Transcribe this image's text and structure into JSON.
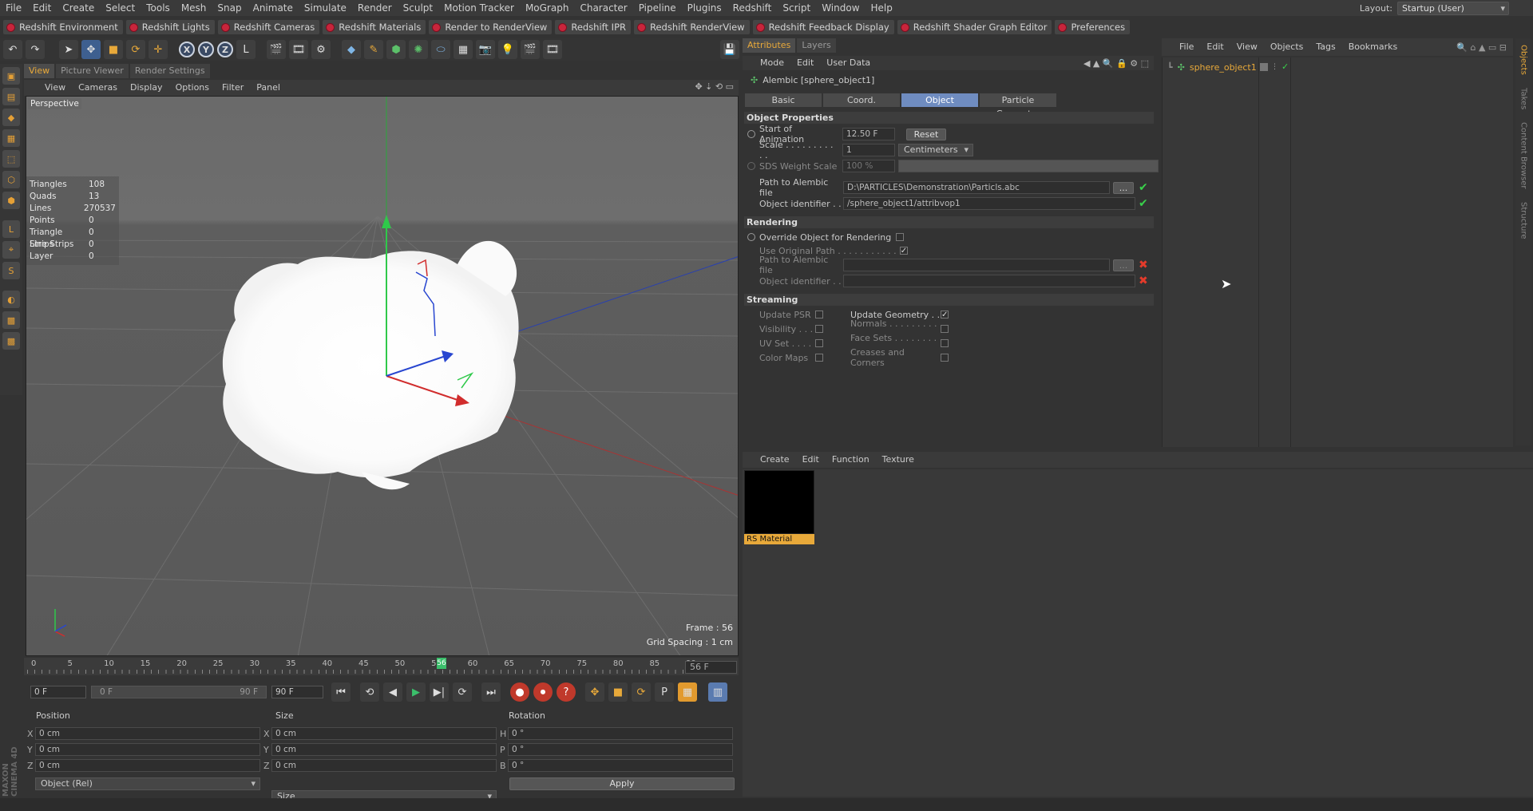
{
  "menubar": {
    "items": [
      "File",
      "Edit",
      "Create",
      "Select",
      "Tools",
      "Mesh",
      "Snap",
      "Animate",
      "Simulate",
      "Render",
      "Sculpt",
      "Motion Tracker",
      "MoGraph",
      "Character",
      "Pipeline",
      "Plugins",
      "Redshift",
      "Script",
      "Window",
      "Help"
    ],
    "layout_label": "Layout:",
    "layout_value": "Startup (User)"
  },
  "pluginbar": {
    "items": [
      "Redshift Environment",
      "Redshift Lights",
      "Redshift Cameras",
      "Redshift Materials",
      "Render to RenderView",
      "Redshift IPR",
      "Redshift RenderView",
      "Redshift Feedback Display",
      "Redshift Shader Graph Editor",
      "Preferences"
    ]
  },
  "toolbar": {
    "axis_x": "X",
    "axis_y": "Y",
    "axis_z": "Z"
  },
  "viewport": {
    "tabs": [
      "View",
      "Picture Viewer",
      "Render Settings"
    ],
    "menu": [
      "View",
      "Cameras",
      "Display",
      "Options",
      "Filter",
      "Panel"
    ],
    "camera_label": "Perspective",
    "stats": [
      {
        "k": "Triangles",
        "v": "108"
      },
      {
        "k": "Quads",
        "v": "13"
      },
      {
        "k": "Lines",
        "v": "270537"
      },
      {
        "k": "Points",
        "v": "0"
      },
      {
        "k": "Triangle Strips",
        "v": "0"
      },
      {
        "k": "Line Strips",
        "v": "0"
      },
      {
        "k": "Layer",
        "v": "0"
      }
    ],
    "frame_readout": "Frame : 56",
    "grid_readout": "Grid Spacing : 1 cm"
  },
  "timeline": {
    "ticks": [
      "0",
      "5",
      "10",
      "15",
      "20",
      "25",
      "30",
      "35",
      "40",
      "45",
      "50",
      "55",
      "60",
      "65",
      "70",
      "75",
      "80",
      "85",
      "90"
    ],
    "current_frame": "56",
    "end_field": "56 F",
    "start_field": "0 F",
    "range_start": "0 F",
    "range_end": "90 F",
    "max_field": "90 F",
    "playhead_fraction": 0.622
  },
  "coords": {
    "headers": {
      "position": "Position",
      "size": "Size",
      "rotation": "Rotation"
    },
    "rows": [
      {
        "pa": "X",
        "pv": "0 cm",
        "sa": "X",
        "sv": "0 cm",
        "ra": "H",
        "rv": "0 °"
      },
      {
        "pa": "Y",
        "pv": "0 cm",
        "sa": "Y",
        "sv": "0 cm",
        "ra": "P",
        "rv": "0 °"
      },
      {
        "pa": "Z",
        "pv": "0 cm",
        "sa": "Z",
        "sv": "0 cm",
        "ra": "B",
        "rv": "0 °"
      }
    ],
    "mode_dropdown": "Object (Rel)",
    "size_dropdown": "Size",
    "apply_label": "Apply",
    "logo_text": "MAXON CINEMA 4D"
  },
  "attributes": {
    "tabs": [
      "Attributes",
      "Layers"
    ],
    "menu": [
      "Mode",
      "Edit",
      "User Data"
    ],
    "title": "Alembic [sphere_object1]",
    "subtabs": [
      "Basic",
      "Coord.",
      "Object",
      "Particle Geometry"
    ],
    "object_properties": {
      "section": "Object Properties",
      "start_label": "Start of Animation",
      "start_value": "12.50 F",
      "reset_label": "Reset",
      "scale_label": "Scale . . . . . . . . . . .",
      "scale_value": "1",
      "scale_unit": "Centimeters",
      "sds_label": "SDS Weight Scale",
      "sds_value": "100 %",
      "path_label": "Path to Alembic file",
      "path_value": "D:\\PARTICLES\\Demonstration\\Particls.abc",
      "browse_label": "...",
      "ident_label": "Object identifier . .",
      "ident_value": "/sphere_object1/attribvop1"
    },
    "rendering": {
      "section": "Rendering",
      "override_label": "Override Object for Rendering",
      "orig_label": "Use Original Path . . . . . . . . . . .",
      "path_label": "Path to Alembic file",
      "ident_label": "Object identifier . .",
      "browse_label": "..."
    },
    "streaming": {
      "section": "Streaming",
      "left": [
        "Update PSR",
        "Visibility . . .",
        "UV Set . . . .",
        "Color Maps"
      ],
      "right": [
        "Update Geometry . .",
        "Normals . . . . . . . . . .",
        "Face Sets . . . . . . . . .",
        "Creases and Corners"
      ]
    }
  },
  "objects": {
    "menu": [
      "File",
      "Edit",
      "View",
      "Objects",
      "Tags",
      "Bookmarks"
    ],
    "item_name": "sphere_object1",
    "side_tabs": [
      "Objects",
      "Takes",
      "Content Browser",
      "Structure"
    ]
  },
  "materials": {
    "menu": [
      "Create",
      "Edit",
      "Function",
      "Texture"
    ],
    "material_name": "RS Material"
  },
  "colors": {
    "accent": "#e8a93a",
    "ok": "#39d14b",
    "error": "#e43b2b",
    "active_tab": "#6f8cc0"
  }
}
